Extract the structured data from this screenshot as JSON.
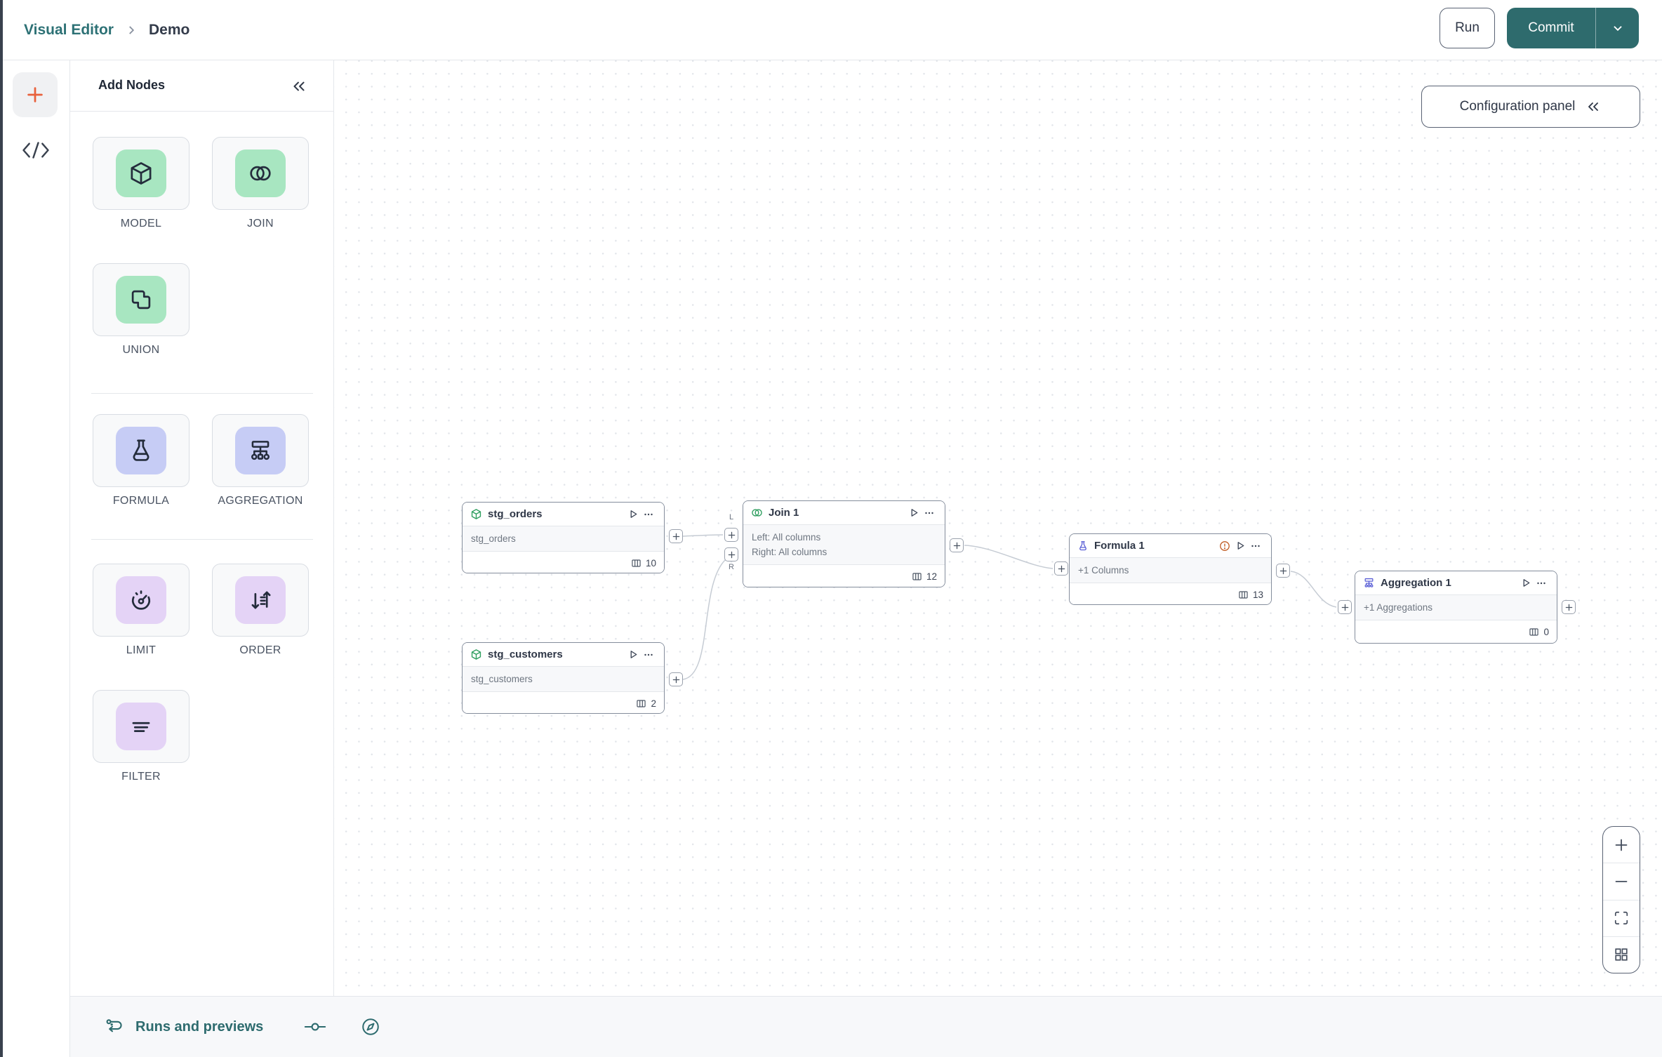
{
  "header": {
    "breadcrumb_root": "Visual Editor",
    "breadcrumb_current": "Demo",
    "run_label": "Run",
    "commit_label": "Commit"
  },
  "panel": {
    "title": "Add Nodes",
    "tiles": [
      {
        "label": "MODEL",
        "icon": "cube",
        "color": "green"
      },
      {
        "label": "JOIN",
        "icon": "join-circles",
        "color": "green"
      },
      {
        "label": "UNION",
        "icon": "union-squares",
        "color": "green"
      },
      {
        "label": "FORMULA",
        "icon": "flask",
        "color": "indigo"
      },
      {
        "label": "AGGREGATION",
        "icon": "hierarchy",
        "color": "indigo"
      },
      {
        "label": "LIMIT",
        "icon": "gauge",
        "color": "purple"
      },
      {
        "label": "ORDER",
        "icon": "sort-arrows",
        "color": "purple"
      },
      {
        "label": "FILTER",
        "icon": "filter-lines",
        "color": "purple"
      }
    ]
  },
  "canvas": {
    "config_button_label": "Configuration panel",
    "nodes": [
      {
        "title": "stg_orders",
        "icon": "cube",
        "body_lines": [
          "stg_orders"
        ],
        "columns": "10"
      },
      {
        "title": "stg_customers",
        "icon": "cube",
        "body_lines": [
          "stg_customers"
        ],
        "columns": "2"
      },
      {
        "title": "Join 1",
        "icon": "join-circles",
        "body_lines": [
          "Left: All columns",
          "Right: All columns"
        ],
        "columns": "12"
      },
      {
        "title": "Formula 1",
        "icon": "flask",
        "body_lines": [
          "+1 Columns"
        ],
        "columns": "13",
        "has_warning": true
      },
      {
        "title": "Aggregation 1",
        "icon": "hierarchy",
        "body_lines": [
          "+1 Aggregations"
        ],
        "columns": "0"
      }
    ],
    "join_ports": {
      "left": "L",
      "right": "R"
    }
  },
  "bottom_bar": {
    "runs_label": "Runs and previews"
  },
  "colors": {
    "teal": "#2e6b6d",
    "teal_link": "#2d7175",
    "orange_plus": "#e8613c",
    "warning_orange": "#c05a21",
    "green_icon_bg": "#a8e6c1",
    "indigo_icon_bg": "#c6ccf5",
    "purple_icon_bg": "#e4d3f6",
    "node_icon_green": "#2e9e5f",
    "node_icon_indigo": "#5a5fd6"
  }
}
